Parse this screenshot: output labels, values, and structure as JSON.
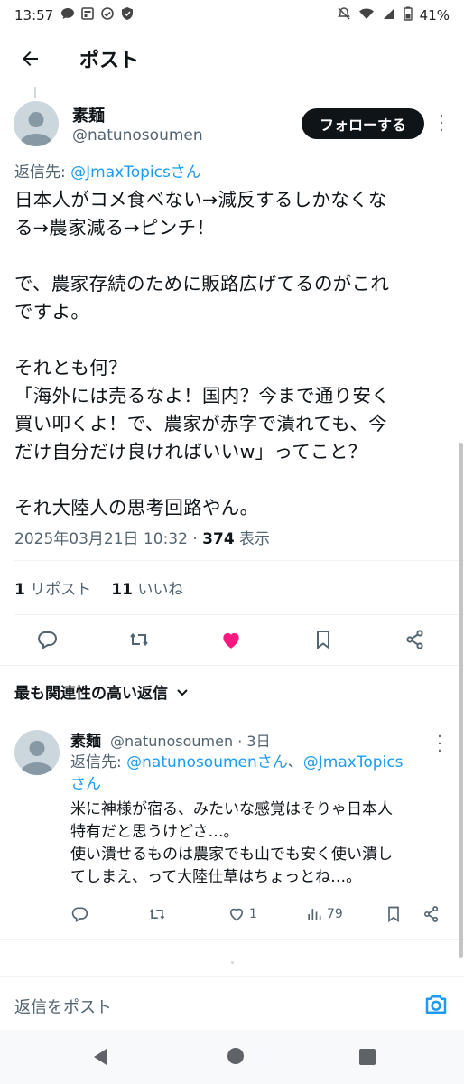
{
  "status_bar": {
    "time": "13:57",
    "battery": "41%"
  },
  "header": {
    "title": "ポスト"
  },
  "tweet": {
    "author_name": "素麺",
    "author_handle": "@natunosoumen",
    "follow_label": "フォローする",
    "reply_to_prefix": "返信先: ",
    "reply_to_handle": "@JmaxTopicsさん",
    "body": {
      "p1_l1": "日本人がコメ食べない→減反するしかなくな",
      "p1_l2": "る→農家減る→ピンチ！",
      "p2_l1": "で、農家存続のために販路広げてるのがこれ",
      "p2_l2": "ですよ。",
      "p3_l1": "それとも何？",
      "p3_l2": "「海外には売るなよ！国内？今まで通り安く",
      "p3_l3": "買い叩くよ！で、農家が赤字で潰れても、今",
      "p3_l4": "だけ自分だけ良ければいいw」ってこと？",
      "p4_l1": "それ大陸人の思考回路やん。"
    },
    "timestamp": "2025年03月21日 10:32",
    "separator": " · ",
    "views_count": "374",
    "views_label": " 表示",
    "reposts_count": "1",
    "reposts_label": " リポスト",
    "likes_count": "11",
    "likes_label": " いいね"
  },
  "replies_section": {
    "sort_label": "最も関連性の高い返信"
  },
  "reply": {
    "author_name": "素麺",
    "author_handle_time": "@natunosoumen · 3日",
    "reply_to_prefix": "返信先: ",
    "reply_to_handle1": "@natunosoumenさん",
    "reply_to_sep": "、",
    "reply_to_handle2": "@JmaxTopics",
    "reply_to_suffix": "さん",
    "text_l1": "米に神様が宿る、みたいな感覚はそりゃ日本人",
    "text_l2": "特有だと思うけどさ…。",
    "text_l3": "使い潰せるものは農家でも山でも安く使い潰し",
    "text_l4": "てしまえ、って大陸仕草はちょっとね…。",
    "likes_count": "1",
    "views_count": "79"
  },
  "compose": {
    "placeholder": "返信をポスト"
  },
  "colors": {
    "text": "#0f1419",
    "muted": "#536471",
    "link": "#1d9bf0",
    "like": "#f91880"
  }
}
